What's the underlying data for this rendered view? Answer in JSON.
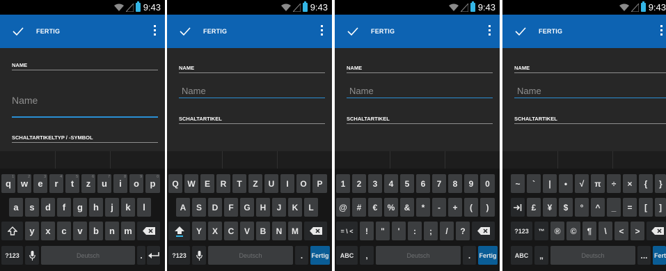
{
  "status": {
    "time": "9:43"
  },
  "action_bar": {
    "done_label": "FERTIG"
  },
  "screens": [
    {
      "label_name": "NAME",
      "name_placeholder": "Name",
      "label_second": "SCHALTARTIKELTYP / -SYMBOL"
    },
    {
      "label_name": "NAME",
      "name_placeholder": "Name",
      "label_second": "SCHALTARTIKEL"
    },
    {
      "label_name": "NAME",
      "name_placeholder": "Name",
      "label_second": "SCHALTARTIKEL"
    },
    {
      "label_name": "NAME",
      "name_placeholder": "Name",
      "label_second": "SCHALTARTIKEL"
    }
  ],
  "keyboards": {
    "lower": {
      "row1": [
        "q",
        "w",
        "e",
        "r",
        "t",
        "z",
        "u",
        "i",
        "o",
        "p"
      ],
      "row1_hints": [
        "1",
        "2",
        "3",
        "4",
        "5",
        "6",
        "7",
        "8",
        "9",
        "0"
      ],
      "row2": [
        "a",
        "s",
        "d",
        "f",
        "g",
        "h",
        "j",
        "k",
        "l"
      ],
      "row3": [
        "y",
        "x",
        "c",
        "v",
        "b",
        "n",
        "m"
      ],
      "symbols_key": "?123",
      "space_label": "Deutsch",
      "period": "."
    },
    "upper": {
      "row1": [
        "Q",
        "W",
        "E",
        "R",
        "T",
        "Z",
        "U",
        "I",
        "O",
        "P"
      ],
      "row2": [
        "A",
        "S",
        "D",
        "F",
        "G",
        "H",
        "J",
        "K",
        "L"
      ],
      "row3": [
        "Y",
        "X",
        "C",
        "V",
        "B",
        "N",
        "M"
      ],
      "symbols_key": "?123",
      "space_label": "Deutsch",
      "period": ".",
      "action_label": "Fertig"
    },
    "numbers": {
      "row1": [
        "1",
        "2",
        "3",
        "4",
        "5",
        "6",
        "7",
        "8",
        "9",
        "0"
      ],
      "row2": [
        "@",
        "#",
        "€",
        "%",
        "&",
        "*",
        "-",
        "+",
        "(",
        ")"
      ],
      "row3_first": "= \\ <",
      "row3": [
        "!",
        "\"",
        "'",
        ":",
        ";",
        "/",
        "?"
      ],
      "abc_key": "ABC",
      "comma": ",",
      "space_label": "Deutsch",
      "period": ".",
      "action_label": "Fertig"
    },
    "symbols": {
      "row1": [
        "~",
        "`",
        "|",
        "•",
        "√",
        "π",
        "÷",
        "×",
        "{",
        "}"
      ],
      "row2": [
        "£",
        "¥",
        "$",
        "°",
        "^",
        "_",
        "=",
        "[",
        "]"
      ],
      "row3_first": "™",
      "row3": [
        "®",
        "©",
        "¶",
        "\\",
        "<",
        ">"
      ],
      "numbers_key": "?123",
      "abc_key": "ABC",
      "quote": "„",
      "space_label": "Deutsch",
      "ellipsis": "...",
      "action_label": "Fertig"
    }
  }
}
